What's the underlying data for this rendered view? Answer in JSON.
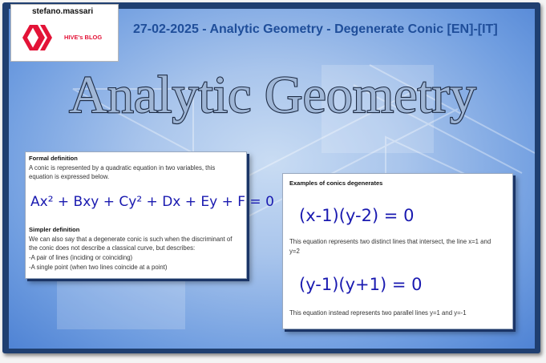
{
  "header": {
    "username": "stefano.massari",
    "blog_label": "HIVE's BLOG",
    "post_title": "27-02-2025 - Analytic Geometry - Degenerate Conic [EN]-[IT]"
  },
  "banner": {
    "title": "Analytic Geometry"
  },
  "card1": {
    "formal_heading": "Formal definition",
    "formal_text_1": "A conic is represented by a quadratic equation in two variables, this",
    "formal_text_2": "equation is expressed below.",
    "equation": "Ax² + Bxy + Cy² + Dx + Ey + F = 0",
    "simpler_heading": "Simpler definition",
    "simpler_text_1": "We can also say that a degenerate conic is such when the discriminant of",
    "simpler_text_2": "the conic does not describe a classical curve, but describes:",
    "bullet_1": "-A pair of lines (inciding or coinciding)",
    "bullet_2": "-A single point (when two lines coincide at a point)"
  },
  "card2": {
    "heading": "Examples of conics degenerates",
    "equation_1": "(x-1)(y-2) = 0",
    "text_1a": "This equation represents two distinct lines that intersect, the line x=1 and",
    "text_1b": "y=2",
    "equation_2": "(y-1)(y+1) = 0",
    "text_2": "This equation instead represents two parallel lines y=1 and y=-1"
  },
  "colors": {
    "frame": "#1f3f70",
    "title_blue": "#1f4e9a",
    "hive_red": "#e31337",
    "handwriting": "#1a1ab0"
  }
}
